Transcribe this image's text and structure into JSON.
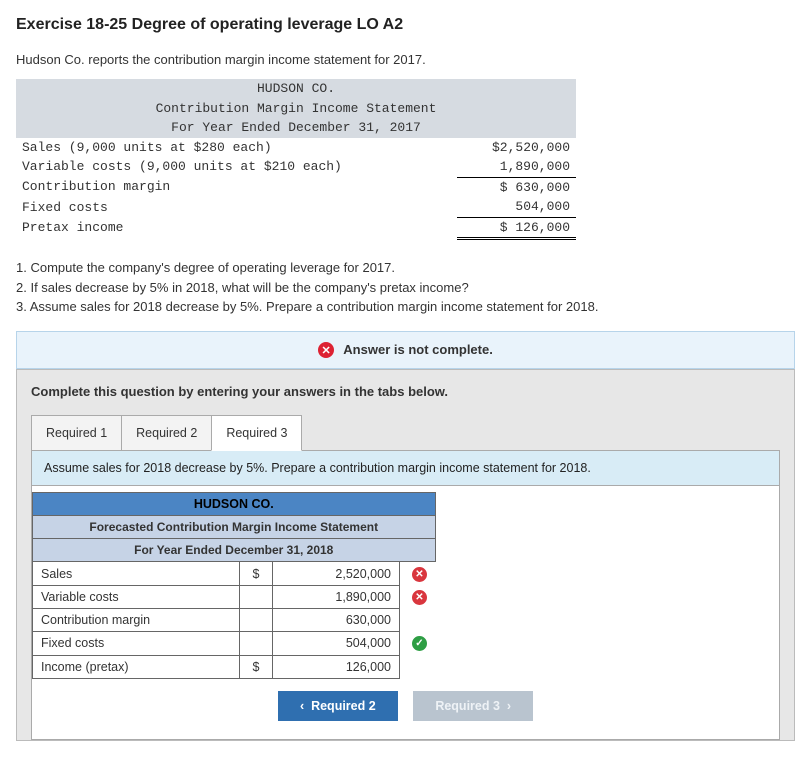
{
  "title": "Exercise 18-25 Degree of operating leverage LO A2",
  "intro": "Hudson Co. reports the contribution margin income statement for 2017.",
  "statement2017": {
    "company": "HUDSON CO.",
    "head1": "Contribution Margin Income Statement",
    "head2": "For Year Ended December 31, 2017",
    "rows": {
      "sales_label": "Sales (9,000 units at $280 each)",
      "sales_amt": "$2,520,000",
      "var_label": "Variable costs (9,000 units at $210 each)",
      "var_amt": "1,890,000",
      "cm_label": "Contribution margin",
      "cm_amt": "$  630,000",
      "fixed_label": "Fixed costs",
      "fixed_amt": "504,000",
      "pretax_label": "Pretax income",
      "pretax_amt": "$  126,000"
    }
  },
  "questions": {
    "q1": "1. Compute the company's degree of operating leverage for 2017.",
    "q2": "2. If sales decrease by 5% in 2018, what will be the company's pretax income?",
    "q3": "3. Assume sales for 2018 decrease by 5%. Prepare a contribution margin income statement for 2018."
  },
  "alert": "Answer is not complete.",
  "panel_instr": "Complete this question by entering your answers in the tabs below.",
  "tabs": {
    "t1": "Required 1",
    "t2": "Required 2",
    "t3": "Required 3"
  },
  "subprompt": "Assume sales for 2018 decrease by 5%. Prepare a contribution margin income statement for 2018.",
  "forecast": {
    "company": "HUDSON CO.",
    "head1": "Forecasted Contribution Margin Income Statement",
    "head2": "For Year Ended December 31, 2018",
    "rows": {
      "sales_label": "Sales",
      "sales_cur": "$",
      "sales_val": "2,520,000",
      "var_label": "Variable costs",
      "var_val": "1,890,000",
      "cm_label": "Contribution margin",
      "cm_val": "630,000",
      "fixed_label": "Fixed costs",
      "fixed_val": "504,000",
      "inc_label": "Income (pretax)",
      "inc_cur": "$",
      "inc_val": "126,000"
    }
  },
  "nav": {
    "prev": "Required 2",
    "next": "Required 3"
  },
  "chart_data": {
    "type": "table",
    "title": "HUDSON CO. Contribution Margin Income Statement, Year Ended Dec 31 2017",
    "rows": [
      {
        "item": "Sales",
        "units": 9000,
        "unit_price": 280,
        "amount": 2520000
      },
      {
        "item": "Variable costs",
        "units": 9000,
        "unit_price": 210,
        "amount": 1890000
      },
      {
        "item": "Contribution margin",
        "amount": 630000
      },
      {
        "item": "Fixed costs",
        "amount": 504000
      },
      {
        "item": "Pretax income",
        "amount": 126000
      }
    ]
  }
}
